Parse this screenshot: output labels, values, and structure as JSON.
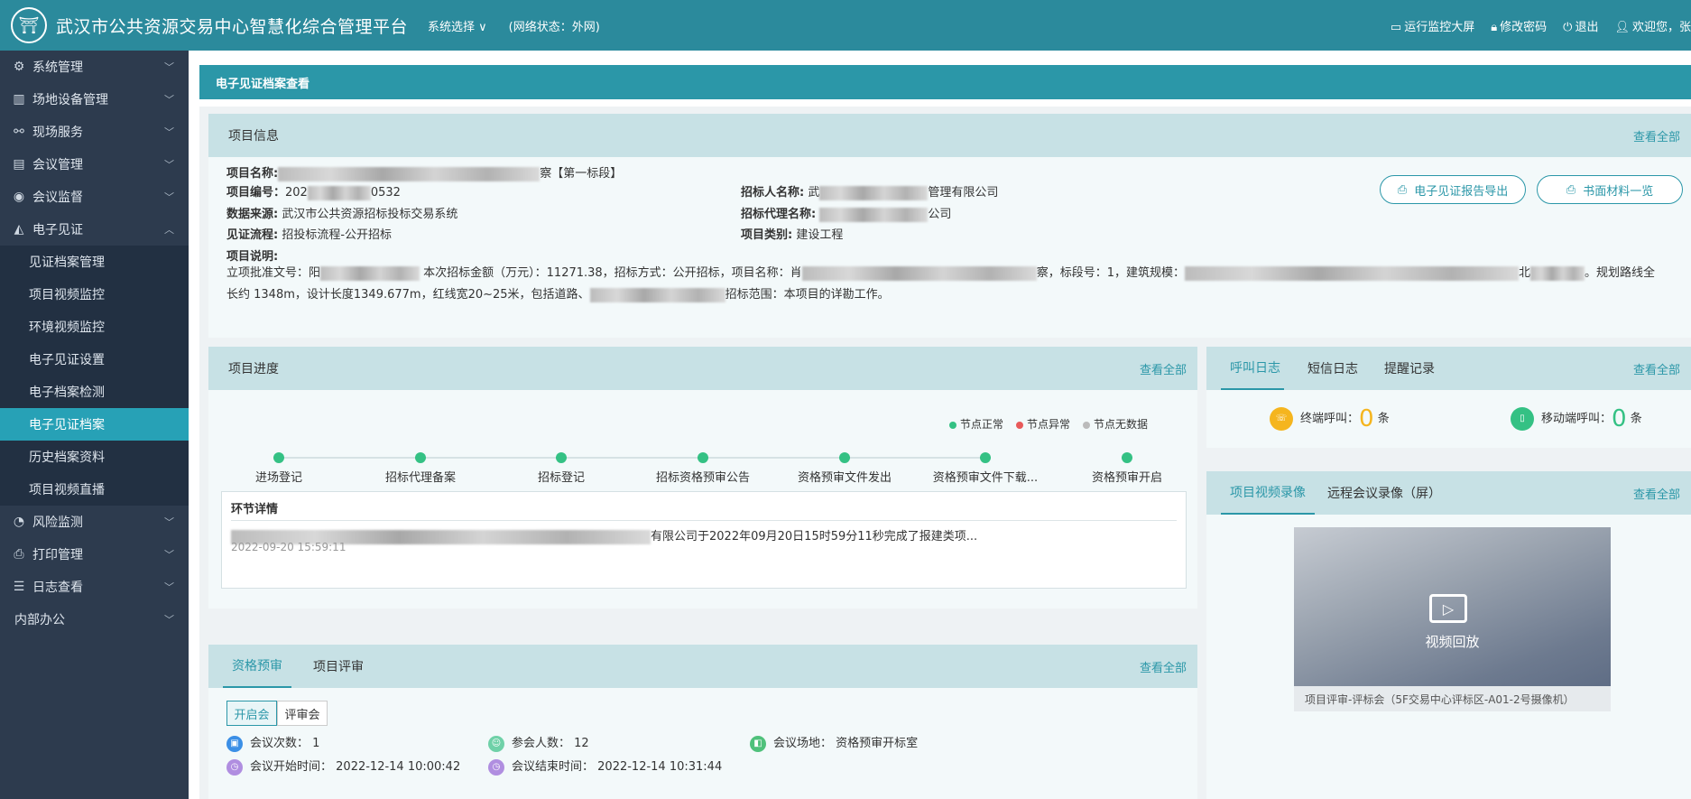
{
  "header": {
    "logo_glyph": "⛩",
    "title": "武汉市公共资源交易中心智慧化综合管理平台",
    "system_select": "系统选择 ∨",
    "network_status": "(网络状态：外网)",
    "links": {
      "monitor_screen": "运行监控大屏",
      "change_password": "修改密码",
      "logout": "退出",
      "welcome": "欢迎您，张"
    }
  },
  "sidebar": {
    "items": [
      {
        "label": "系统管理",
        "icon": "gear-icon"
      },
      {
        "label": "场地设备管理",
        "icon": "building-icon"
      },
      {
        "label": "现场服务",
        "icon": "service-icon"
      },
      {
        "label": "会议管理",
        "icon": "meeting-icon"
      },
      {
        "label": "会议监督",
        "icon": "supervise-icon"
      },
      {
        "label": "电子见证",
        "icon": "witness-icon"
      }
    ],
    "sub_items": [
      "见证档案管理",
      "项目视频监控",
      "环境视频监控",
      "电子见证设置",
      "电子档案检测",
      "电子见证档案",
      "历史档案资料",
      "项目视频直播"
    ],
    "items_after": [
      {
        "label": "风险监测",
        "icon": "risk-icon"
      },
      {
        "label": "打印管理",
        "icon": "print-icon"
      },
      {
        "label": "日志查看",
        "icon": "log-icon"
      },
      {
        "label": "内部办公",
        "icon": ""
      }
    ]
  },
  "breadcrumb": "电子见证档案查看",
  "project_info": {
    "title": "项目信息",
    "see_all": "查看全部",
    "name_label": "项目名称:",
    "name_suffix": "察【第一标段】",
    "code_label": "项目编号：",
    "code_prefix": "202",
    "code_suffix": "0532",
    "source_label": "数据来源:",
    "source_value": "武汉市公共资源招标投标交易系统",
    "process_label": "见证流程:",
    "process_value": "招投标流程-公开招标",
    "tenderer_label": "招标人名称:",
    "tenderer_prefix": "武",
    "tenderer_suffix": "管理有限公司",
    "agent_label": "招标代理名称:",
    "agent_suffix": "公司",
    "category_label": "项目类别:",
    "category_value": "建设工程",
    "desc_label": "项目说明:",
    "desc_line1_a": "立项批准文号：阳",
    "desc_line1_b": "本次招标金额（万元）：11271.38，招标方式：公开招标，项目名称：肖",
    "desc_line1_c": "察，标段号：1，建筑规模：",
    "desc_line1_d": "北",
    "desc_line1_e": "。规划路线全",
    "desc_line2_a": "长约 1348m，设计长度1349.677m，红线宽20~25米，包括道路、",
    "desc_line2_b": "招标范围：本项目的详勘工作。",
    "btn_report": "电子见证报告导出",
    "btn_materials": "书面材料一览"
  },
  "progress": {
    "title": "项目进度",
    "see_all": "查看全部",
    "legend": [
      {
        "label": "节点正常",
        "color": "#34c184"
      },
      {
        "label": "节点异常",
        "color": "#e85a5a"
      },
      {
        "label": "节点无数据",
        "color": "#bbbbbb"
      }
    ],
    "nodes": [
      "进场登记",
      "招标代理备案",
      "招标登记",
      "招标资格预审公告",
      "资格预审文件发出",
      "资格预审文件下载...",
      "资格预审开启"
    ],
    "detail_title": "环节详情",
    "detail_text": "有限公司于2022年09月20日15时59分11秒完成了报建类项...",
    "detail_time": "2022-09-20 15:59:11"
  },
  "call_log": {
    "tabs": [
      "呼叫日志",
      "短信日志",
      "提醒记录"
    ],
    "see_all": "查看全部",
    "terminal_label": "终端呼叫：",
    "terminal_count": "0",
    "mobile_label": "移动端呼叫：",
    "mobile_count": "0",
    "unit": "条"
  },
  "video": {
    "tabs": [
      "项目视频录像",
      "远程会议录像（屏）"
    ],
    "see_all": "查看全部",
    "play_label": "视频回放",
    "caption": "项目评审-评标会（5F交易中心评标区-A01-2号摄像机）"
  },
  "review": {
    "tabs": [
      "资格预审",
      "项目评审"
    ],
    "see_all": "查看全部",
    "segments": [
      "开启会",
      "评审会"
    ],
    "meeting_count_label": "会议次数：",
    "meeting_count": "1",
    "attendees_label": "参会人数：",
    "attendees": "12",
    "venue_label": "会议场地：",
    "venue": "资格预审开标室",
    "start_label": "会议开始时间：",
    "start": "2022-12-14 10:00:42",
    "end_label": "会议结束时间：",
    "end": "2022-12-14 10:31:44"
  }
}
